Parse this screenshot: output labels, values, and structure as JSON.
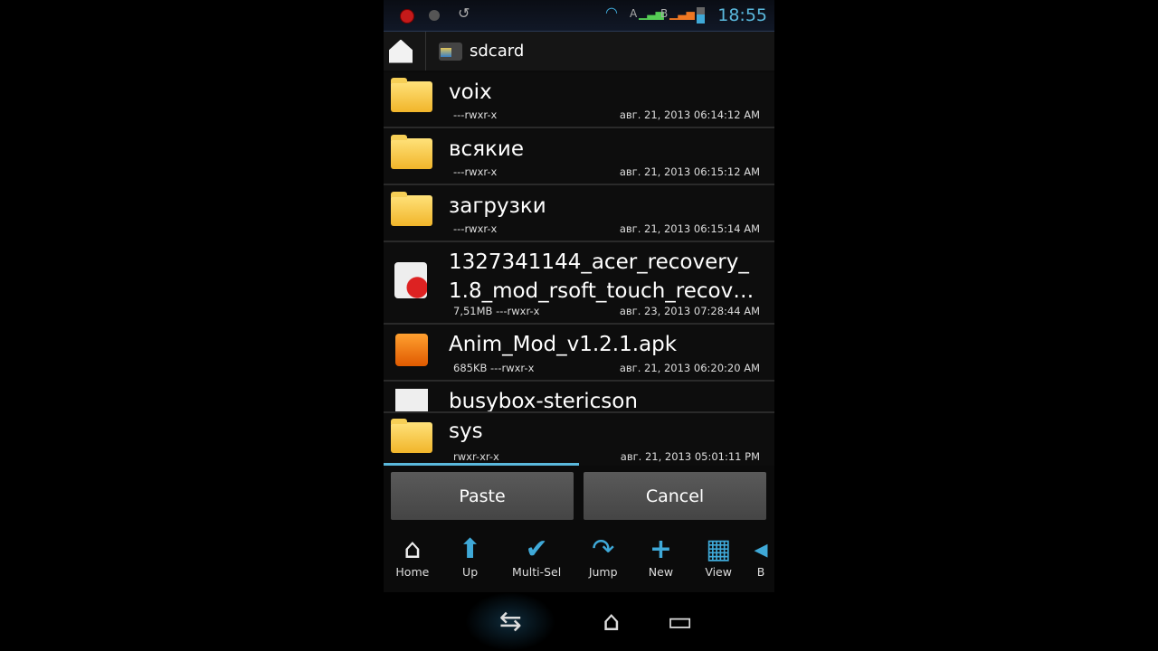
{
  "status": {
    "time": "18:55",
    "sim_a": "A",
    "sim_b": "B"
  },
  "breadcrumb": {
    "path": "sdcard"
  },
  "files": [
    {
      "name": "voix",
      "perm": "---rwxr-x",
      "date": "авг. 21, 2013 06:14:12 AM",
      "type": "folder"
    },
    {
      "name": "всякие",
      "perm": "---rwxr-x",
      "date": "авг. 21, 2013 06:15:12 AM",
      "type": "folder"
    },
    {
      "name": "загрузки",
      "perm": "---rwxr-x",
      "date": "авг. 21, 2013 06:15:14 AM",
      "type": "folder"
    },
    {
      "name": "1327341144_acer_recovery_\n1.8_mod_rsoft_touch_recov…",
      "perm": "7,51MB ---rwxr-x",
      "date": "авг. 23, 2013 07:28:44 AM",
      "type": "archive"
    },
    {
      "name": "Anim_Mod_v1.2.1.apk",
      "perm": "685KB ---rwxr-x",
      "date": "авг. 21, 2013 06:20:20 AM",
      "type": "apk"
    },
    {
      "name": "busybox-stericson",
      "type": "file"
    },
    {
      "name": "sys",
      "perm": "rwxr-xr-x",
      "date": "авг. 21, 2013 05:01:11 PM",
      "type": "folder"
    }
  ],
  "actions": {
    "paste": "Paste",
    "cancel": "Cancel"
  },
  "toolbar": [
    {
      "label": "Home",
      "icon": "home-icon"
    },
    {
      "label": "Up",
      "icon": "up-arrow-icon"
    },
    {
      "label": "Multi-Sel",
      "icon": "checkmark-icon"
    },
    {
      "label": "Jump",
      "icon": "jump-arrow-icon"
    },
    {
      "label": "New",
      "icon": "plus-icon"
    },
    {
      "label": "View",
      "icon": "grid-icon"
    },
    {
      "label": "B",
      "icon": "back-icon"
    }
  ],
  "colors": {
    "accent": "#5ab8dc",
    "folder": "#f1b52a"
  }
}
